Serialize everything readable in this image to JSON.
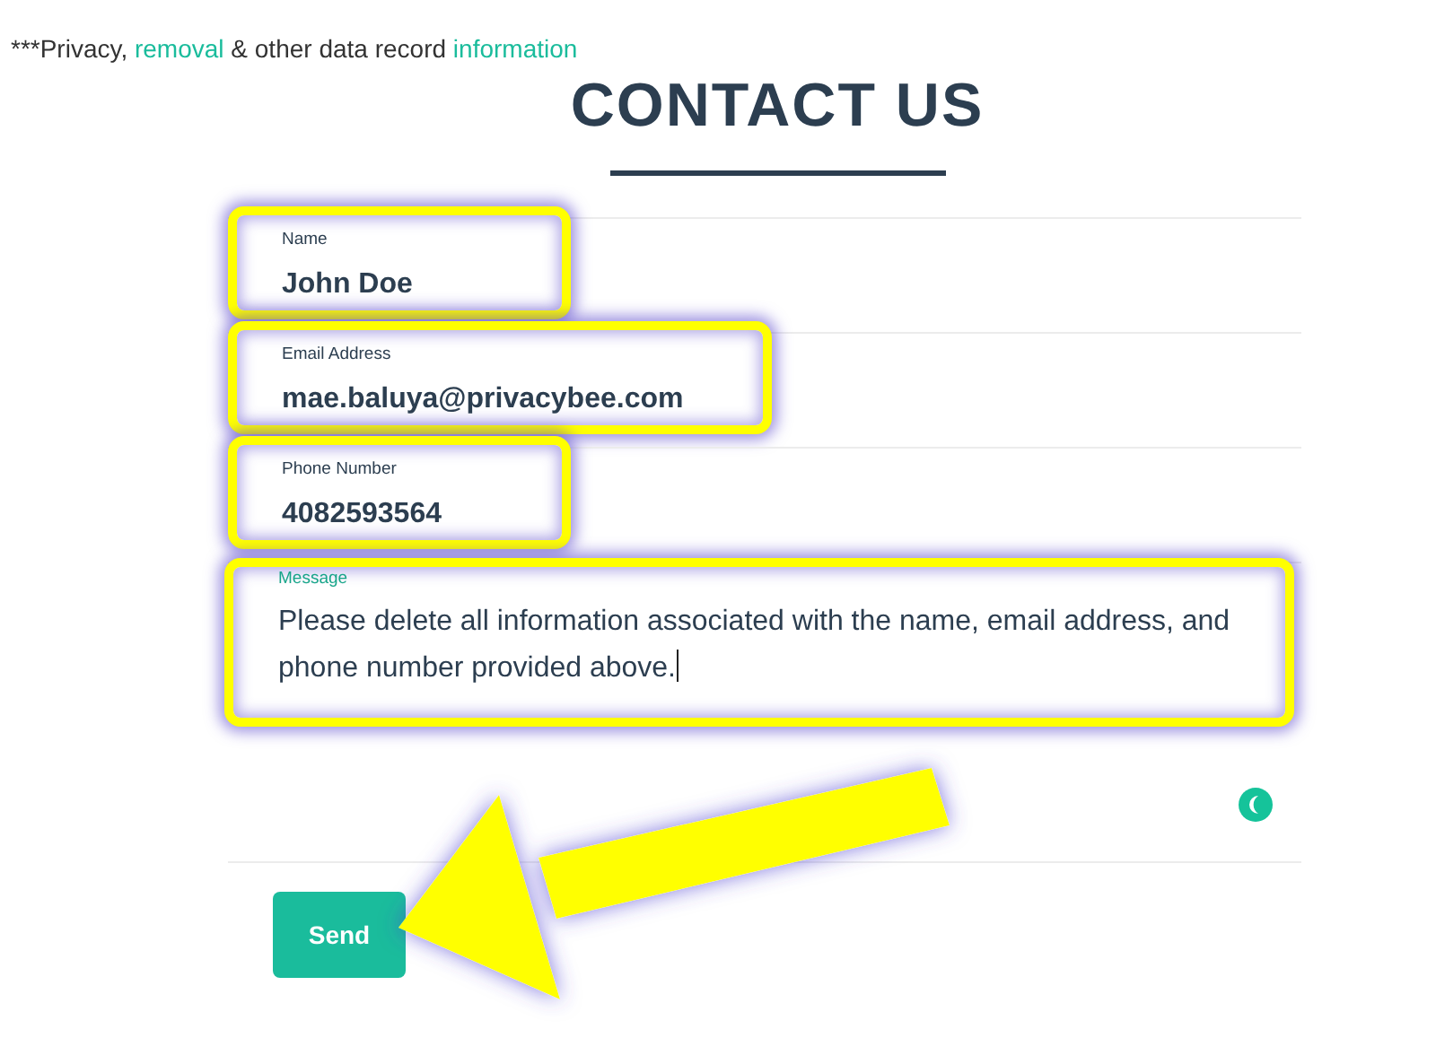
{
  "note": [
    {
      "kind": "text",
      "text": "***Privacy, "
    },
    {
      "kind": "link",
      "text": "removal"
    },
    {
      "kind": "text",
      "text": " & other data record "
    },
    {
      "kind": "link",
      "text": "information"
    }
  ],
  "title": "CONTACT US",
  "fields": [
    {
      "kind": "input",
      "label": "Name",
      "value": "John Doe",
      "focused": false,
      "highlighted": true
    },
    {
      "kind": "input",
      "label": "Email Address",
      "value": "mae.baluya@privacybee.com",
      "focused": false,
      "highlighted": true
    },
    {
      "kind": "input",
      "label": "Phone Number",
      "value": "4082593564",
      "focused": false,
      "highlighted": true
    },
    {
      "kind": "textarea",
      "label": "Message",
      "value": "Please delete all information associated with the name, email address, and phone number provided above.",
      "focused": true,
      "highlighted": true
    }
  ],
  "send_button": "Send"
}
